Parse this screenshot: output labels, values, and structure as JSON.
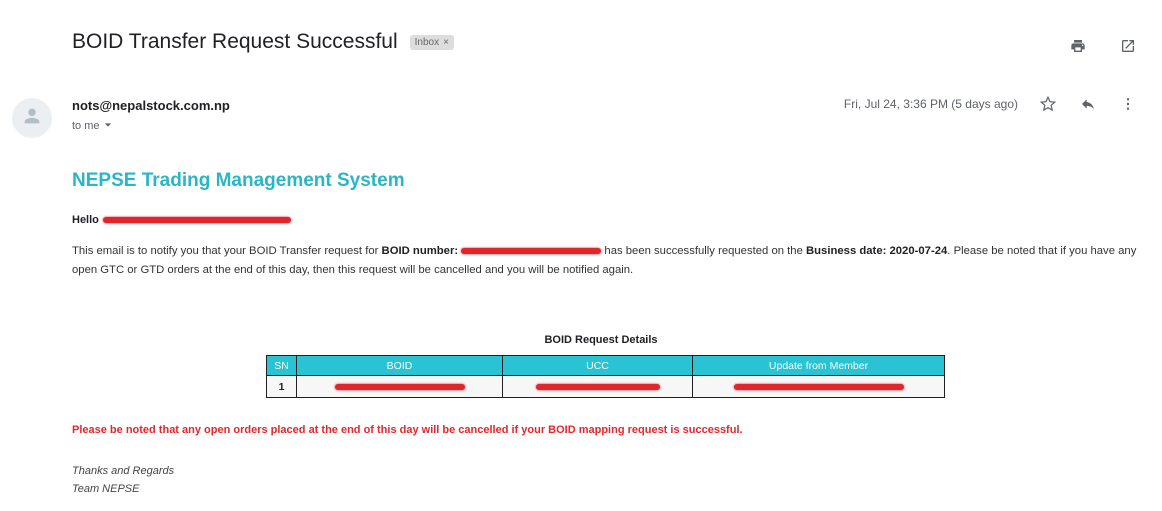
{
  "email": {
    "subject": "BOID Transfer Request Successful",
    "label": "Inbox",
    "label_remove": "×",
    "sender": "nots@nepalstock.com.np",
    "recipient": "to me",
    "date": "Fri, Jul 24, 3:36 PM (5 days ago)"
  },
  "icons": {
    "print": "print-icon",
    "open_new_window": "open-in-new-window-icon",
    "avatar": "person-icon",
    "star": "star-icon",
    "reply": "reply-icon",
    "more": "more-vert-icon",
    "dropdown": "chevron-down-icon"
  },
  "body": {
    "system_title": "NEPSE Trading Management System",
    "greeting": "Hello",
    "para_part1": "This email is to notify you that your BOID Transfer request for ",
    "boid_number_label": "BOID number:",
    "para_part2": "has been successfully requested on the ",
    "business_date_label": "Business date: 2020-07-24",
    "para_part3": ". Please be noted that if you have any open GTC or GTD orders at the end of this day, then this request will be cancelled and you will be notified again.",
    "table_title": "BOID Request Details",
    "table_headers": [
      "SN",
      "BOID",
      "UCC",
      "Update from Member"
    ],
    "table_rows": [
      {
        "sn": "1"
      }
    ],
    "warning": "Please be noted that any open orders placed at the end of this day will be cancelled if your BOID mapping request is successful.",
    "sign_off": "Thanks and Regards",
    "signature": "Team NEPSE"
  },
  "colors": {
    "accent": "#29b6c6",
    "table_header": "#29c3d3",
    "warning": "#e5262b",
    "redaction": "#e0262b"
  }
}
